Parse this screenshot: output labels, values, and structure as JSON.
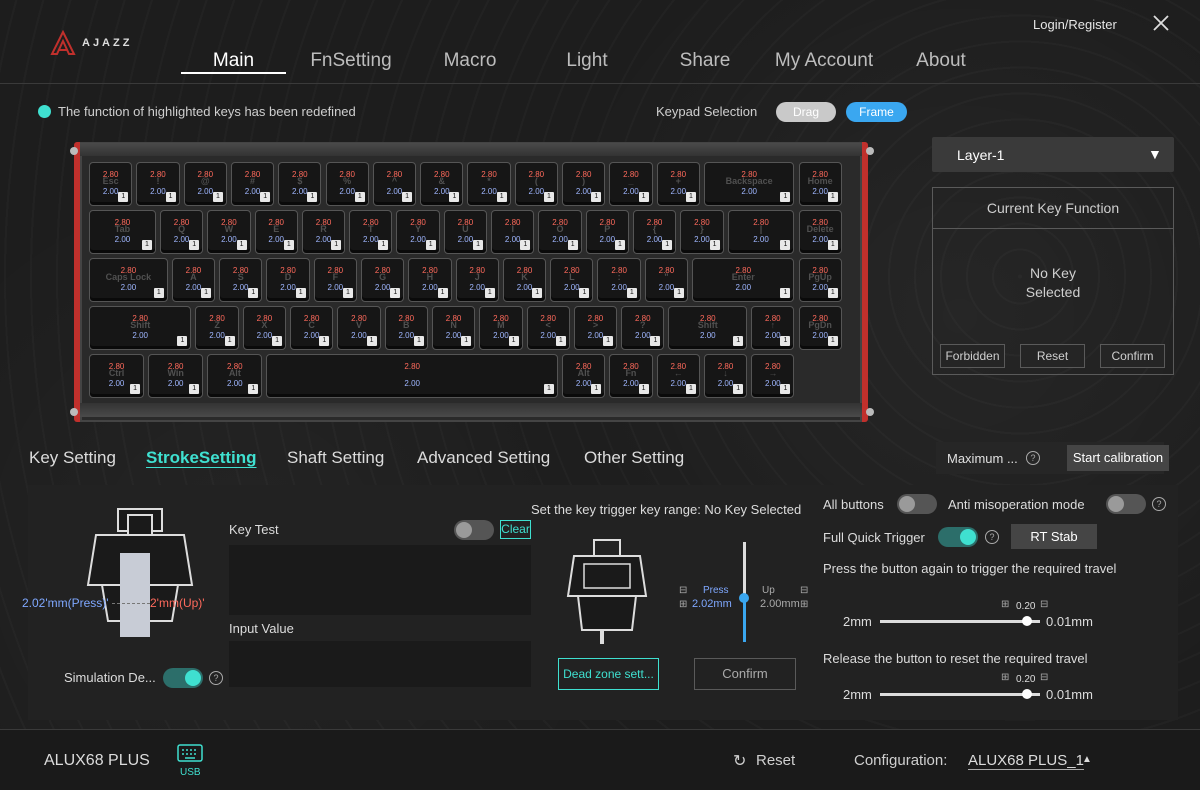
{
  "app": {
    "brand": "AJAZZ"
  },
  "header": {
    "login_label": "Login/Register",
    "nav": [
      {
        "label": "Main",
        "active": true
      },
      {
        "label": "FnSetting"
      },
      {
        "label": "Macro"
      },
      {
        "label": "Light"
      },
      {
        "label": "Share"
      },
      {
        "label": "My Account"
      },
      {
        "label": "About"
      }
    ]
  },
  "info": {
    "highlight_notice": "The function of highlighted keys has been redefined",
    "keypad_selection_label": "Keypad Selection",
    "drag_label": "Drag",
    "frame_label": "Frame"
  },
  "keyboard": {
    "press_value": "2.80",
    "release_value": "2.00",
    "layer_badge": "1",
    "rows": [
      [
        "Esc",
        "!",
        "@",
        "#",
        "$",
        "%",
        "^",
        "&",
        "*",
        "(",
        ")",
        "_",
        "+",
        "Backspace",
        "Home"
      ],
      [
        "Tab",
        "Q",
        "W",
        "E",
        "R",
        "T",
        "Y",
        "U",
        "I",
        "O",
        "P",
        "{",
        "}",
        "|",
        "Delete"
      ],
      [
        "Caps Lock",
        "A",
        "S",
        "D",
        "F",
        "G",
        "H",
        "J",
        "K",
        "L",
        ":",
        "\"",
        "Enter",
        "PgUp"
      ],
      [
        "Shift",
        "Z",
        "X",
        "C",
        "V",
        "B",
        "N",
        "M",
        "<",
        ">",
        "?",
        "Shift",
        "↑",
        "PgDn"
      ],
      [
        "Ctrl",
        "Win",
        "Alt",
        "",
        "Alt",
        "Fn",
        "←",
        "↓",
        "→"
      ]
    ]
  },
  "right_panel": {
    "layer_label": "Layer-1",
    "current_key_function_title": "Current Key Function",
    "no_key_line1": "No Key",
    "no_key_line2": "Selected",
    "forbidden_label": "Forbidden",
    "reset_label": "Reset",
    "confirm_label": "Confirm"
  },
  "tabs": [
    {
      "label": "Key Setting"
    },
    {
      "label": "StrokeSetting",
      "active": true
    },
    {
      "label": "Shaft Setting"
    },
    {
      "label": "Advanced Setting"
    },
    {
      "label": "Other Setting"
    }
  ],
  "calibration": {
    "maximum_label": "Maximum ...",
    "start_label": "Start calibration"
  },
  "stroke": {
    "press_mm": "2.02'mm(Press)'",
    "up_mm": "2'mm(Up)'",
    "simulation_label": "Simulation De...",
    "simulation_on": true,
    "key_test_label": "Key Test",
    "key_test_on": false,
    "clear_label": "Clear",
    "input_value_label": "Input Value",
    "trigger_range_label": "Set the key trigger key range: No Key Selected",
    "dead_zone_label": "Dead zone sett...",
    "confirm_label": "Confirm",
    "press_text": "Press",
    "press_val": "2.02mm",
    "up_text": "Up",
    "up_val": "2.00mm",
    "all_buttons_label": "All buttons",
    "all_buttons_on": false,
    "anti_miso_label": "Anti misoperation mode",
    "anti_miso_on": false,
    "full_quick_label": "Full Quick Trigger",
    "full_quick_on": true,
    "rt_stab_label": "RT Stab",
    "press_again_label": "Press the button again to trigger the required travel",
    "release_label": "Release the button to reset the required travel",
    "slider1": {
      "value": "0.20",
      "min": "2mm",
      "max": "0.01mm"
    },
    "slider2": {
      "value": "0.20",
      "min": "2mm",
      "max": "0.01mm"
    }
  },
  "footer": {
    "model": "ALUX68 PLUS",
    "usb_label": "USB",
    "reset_label": "Reset",
    "config_label": "Configuration:",
    "config_value": "ALUX68 PLUS_1"
  },
  "colors": {
    "accent": "#3fe0d0",
    "frame_pill": "#3aa7f0",
    "keyboard_frame": "#c0302c"
  }
}
